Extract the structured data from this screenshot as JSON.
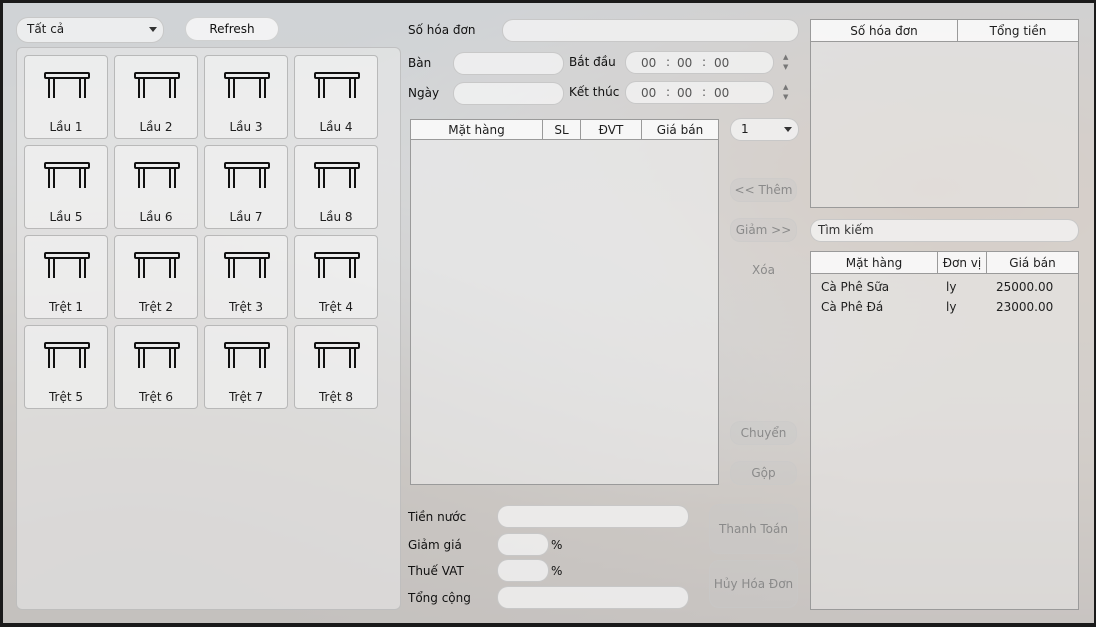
{
  "filter": {
    "selected": "Tất cả"
  },
  "refresh_label": "Refresh",
  "tables": [
    {
      "name": "Lầu 1"
    },
    {
      "name": "Lầu 2"
    },
    {
      "name": "Lầu 3"
    },
    {
      "name": "Lầu 4"
    },
    {
      "name": "Lầu 5"
    },
    {
      "name": "Lầu 6"
    },
    {
      "name": "Lầu 7"
    },
    {
      "name": "Lầu 8"
    },
    {
      "name": "Trệt 1"
    },
    {
      "name": "Trệt 2"
    },
    {
      "name": "Trệt 3"
    },
    {
      "name": "Trệt 4"
    },
    {
      "name": "Trệt 5"
    },
    {
      "name": "Trệt 6"
    },
    {
      "name": "Trệt 7"
    },
    {
      "name": "Trệt 8"
    }
  ],
  "invoice": {
    "number_label": "Số hóa đơn",
    "table_label": "Bàn",
    "date_label": "Ngày",
    "start_label": "Bắt đầu",
    "end_label": "Kết thúc",
    "start_time": {
      "h": "00",
      "m": "00",
      "s": "00"
    },
    "end_time": {
      "h": "00",
      "m": "00",
      "s": "00"
    },
    "columns": [
      "Mặt hàng",
      "SL",
      "ĐVT",
      "Giá bán"
    ],
    "quantity": "1"
  },
  "actions": {
    "add": "<< Thêm",
    "reduce": "Giảm >>",
    "delete": "Xóa",
    "move": "Chuyển",
    "merge": "Gộp",
    "pay": "Thanh Toán",
    "cancel": "Hủy Hóa Đơn"
  },
  "totals": {
    "drinks_label": "Tiền nước",
    "discount_label": "Giảm giá",
    "vat_label": "Thuế VAT",
    "total_label": "Tổng cộng",
    "percent": "%"
  },
  "invoice_list": {
    "columns": [
      "Số hóa đơn",
      "Tổng tiền"
    ]
  },
  "search": {
    "placeholder": "Tìm kiếm"
  },
  "menu": {
    "columns": [
      "Mặt hàng",
      "Đơn vị",
      "Giá bán"
    ],
    "rows": [
      {
        "name": "Cà Phê Sữa",
        "unit": "ly",
        "price": "25000.00"
      },
      {
        "name": "Cà Phê Đá",
        "unit": "ly",
        "price": "23000.00"
      }
    ]
  }
}
